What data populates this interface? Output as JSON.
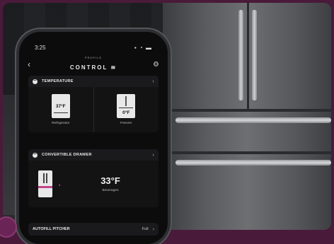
{
  "phone": {
    "status_time": "3:25",
    "status_icons": "▪ ◔ ▬",
    "nav": {
      "back_glyph": "‹",
      "title_sub": "PROFILE",
      "title": "CONTROL",
      "title_icon": "wifi-icon",
      "settings_icon": "gear-icon"
    },
    "temperature": {
      "title": "TEMPERATURE",
      "refrigerator": {
        "value": "37°F",
        "label": "Refrigerator"
      },
      "freezer": {
        "value": "0°F",
        "label": "Freezer"
      }
    },
    "drawer": {
      "title": "CONVERTIBLE DRAWER",
      "temp": "33°F",
      "mode": "Beverages"
    },
    "pitcher": {
      "title": "AUTOFILL PITCHER",
      "state": "Full"
    }
  },
  "colors": {
    "accent_pink": "#c0458a",
    "frame_purple": "#4a1a3a"
  }
}
